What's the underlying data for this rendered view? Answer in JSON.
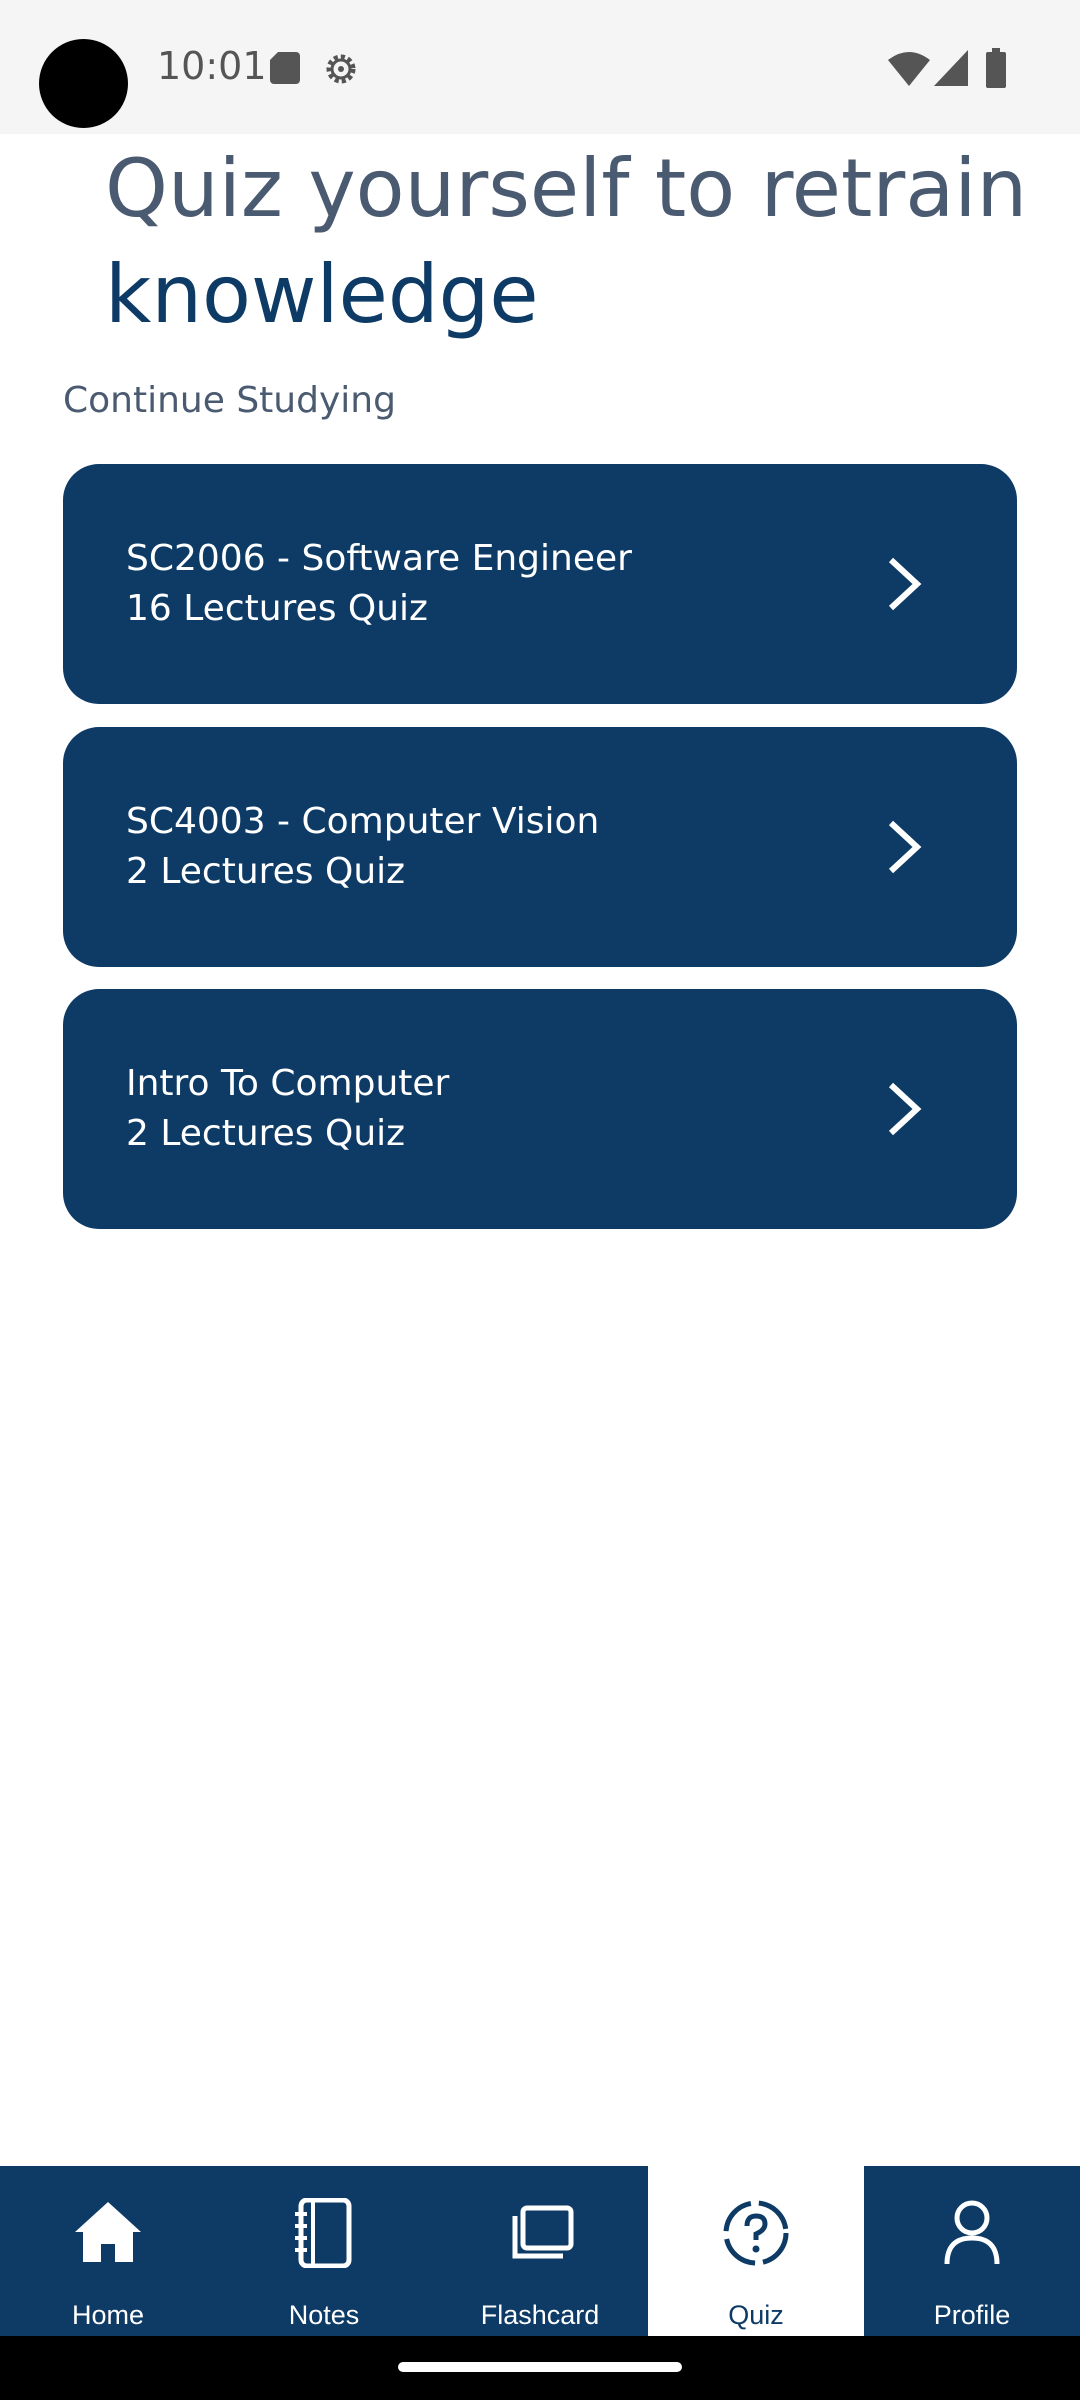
{
  "status_bar": {
    "time": "10:01"
  },
  "header": {
    "title_part1": "Quiz yourself to retrain",
    "title_part2": "knowledge"
  },
  "section": {
    "label": "Continue Studying"
  },
  "quizzes": [
    {
      "title": "SC2006 - Software Engineer",
      "subtitle": "16 Lectures Quiz"
    },
    {
      "title": "SC4003 - Computer Vision",
      "subtitle": "2 Lectures Quiz"
    },
    {
      "title": "Intro To Computer",
      "subtitle": "2 Lectures Quiz"
    }
  ],
  "nav": {
    "items": [
      {
        "label": "Home",
        "icon": "home-icon"
      },
      {
        "label": "Notes",
        "icon": "notebook-icon"
      },
      {
        "label": "Flashcard",
        "icon": "flashcard-icon"
      },
      {
        "label": "Quiz",
        "icon": "quiz-icon",
        "active": true
      },
      {
        "label": "Profile",
        "icon": "profile-icon"
      }
    ]
  },
  "colors": {
    "primary": "#0d3b66",
    "text_muted": "#4a5a70",
    "background": "#ffffff"
  }
}
